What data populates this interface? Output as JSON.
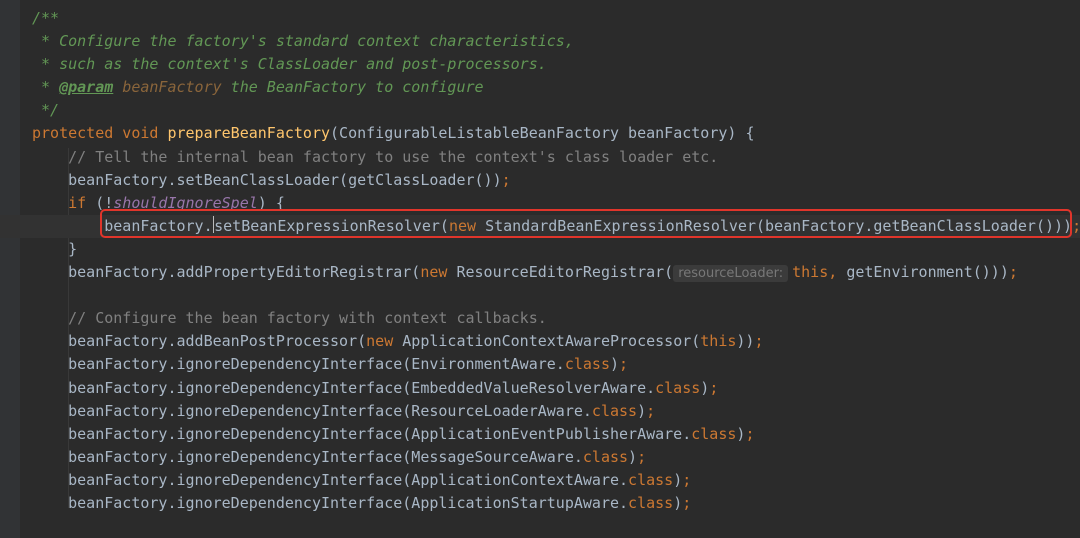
{
  "editor": {
    "lines": [
      {
        "indent": 0,
        "tokens": [
          [
            "cm",
            "/**"
          ]
        ]
      },
      {
        "indent": 0,
        "tokens": [
          [
            "cm",
            " * Configure the factory's standard context characteristics,"
          ]
        ]
      },
      {
        "indent": 0,
        "tokens": [
          [
            "cm",
            " * such as the context's ClassLoader and post-processors."
          ]
        ]
      },
      {
        "indent": 0,
        "tokens": [
          [
            "cm",
            " * "
          ],
          [
            "cm-tag",
            "@param"
          ],
          [
            "cm",
            " "
          ],
          [
            "cm-param",
            "beanFactory"
          ],
          [
            "cm",
            " the BeanFactory to configure"
          ]
        ]
      },
      {
        "indent": 0,
        "tokens": [
          [
            "cm",
            " */"
          ]
        ]
      },
      {
        "indent": 0,
        "tokens": [
          [
            "kw",
            "protected void "
          ],
          [
            "fn",
            "prepareBeanFactory"
          ],
          [
            "",
            "(ConfigurableListableBeanFactory beanFactory) {"
          ]
        ]
      },
      {
        "indent": 1,
        "tokens": [
          [
            "lc",
            "// Tell the internal bean factory to use the context's class loader etc."
          ]
        ]
      },
      {
        "indent": 1,
        "tokens": [
          [
            "",
            "beanFactory.setBeanClassLoader(getClassLoader())"
          ],
          [
            "kw",
            ";"
          ]
        ]
      },
      {
        "indent": 1,
        "tokens": [
          [
            "kw",
            "if "
          ],
          [
            "",
            "(!"
          ],
          [
            "fld",
            "shouldIgnoreSpel"
          ],
          [
            "",
            ") {"
          ]
        ]
      },
      {
        "indent": 2,
        "current": true,
        "tokens": [
          [
            "",
            "beanFactory."
          ],
          [
            "caret",
            ""
          ],
          [
            "",
            "setBeanExpressionResolver("
          ],
          [
            "kw",
            "new "
          ],
          [
            "",
            "StandardBeanExpressionResolver(beanFactory.getBeanClassLoader()))"
          ],
          [
            "kw",
            ";"
          ]
        ]
      },
      {
        "indent": 1,
        "tokens": [
          [
            "",
            "}"
          ]
        ]
      },
      {
        "indent": 1,
        "tokens": [
          [
            "",
            "beanFactory.addPropertyEditorRegistrar("
          ],
          [
            "kw",
            "new "
          ],
          [
            "",
            "ResourceEditorRegistrar("
          ],
          [
            "hint",
            "resourceLoader:"
          ],
          [
            "kw",
            "this, "
          ],
          [
            "",
            "getEnvironment()))"
          ],
          [
            "kw",
            ";"
          ]
        ]
      },
      {
        "indent": 0,
        "tokens": []
      },
      {
        "indent": 1,
        "tokens": [
          [
            "lc",
            "// Configure the bean factory with context callbacks."
          ]
        ]
      },
      {
        "indent": 1,
        "tokens": [
          [
            "",
            "beanFactory.addBeanPostProcessor("
          ],
          [
            "kw",
            "new "
          ],
          [
            "",
            "ApplicationContextAwareProcessor("
          ],
          [
            "kw",
            "this"
          ],
          [
            "",
            "))"
          ],
          [
            "kw",
            ";"
          ]
        ]
      },
      {
        "indent": 1,
        "tokens": [
          [
            "",
            "beanFactory.ignoreDependencyInterface(EnvironmentAware."
          ],
          [
            "kw",
            "class"
          ],
          [
            "",
            ")"
          ],
          [
            "kw",
            ";"
          ]
        ]
      },
      {
        "indent": 1,
        "tokens": [
          [
            "",
            "beanFactory.ignoreDependencyInterface(EmbeddedValueResolverAware."
          ],
          [
            "kw",
            "class"
          ],
          [
            "",
            ")"
          ],
          [
            "kw",
            ";"
          ]
        ]
      },
      {
        "indent": 1,
        "tokens": [
          [
            "",
            "beanFactory.ignoreDependencyInterface(ResourceLoaderAware."
          ],
          [
            "kw",
            "class"
          ],
          [
            "",
            ")"
          ],
          [
            "kw",
            ";"
          ]
        ]
      },
      {
        "indent": 1,
        "tokens": [
          [
            "",
            "beanFactory.ignoreDependencyInterface(ApplicationEventPublisherAware."
          ],
          [
            "kw",
            "class"
          ],
          [
            "",
            ")"
          ],
          [
            "kw",
            ";"
          ]
        ]
      },
      {
        "indent": 1,
        "tokens": [
          [
            "",
            "beanFactory.ignoreDependencyInterface(MessageSourceAware."
          ],
          [
            "kw",
            "class"
          ],
          [
            "",
            ")"
          ],
          [
            "kw",
            ";"
          ]
        ]
      },
      {
        "indent": 1,
        "tokens": [
          [
            "",
            "beanFactory.ignoreDependencyInterface(ApplicationContextAware."
          ],
          [
            "kw",
            "class"
          ],
          [
            "",
            ")"
          ],
          [
            "kw",
            ";"
          ]
        ]
      },
      {
        "indent": 1,
        "tokens": [
          [
            "",
            "beanFactory.ignoreDependencyInterface(ApplicationStartupAware."
          ],
          [
            "kw",
            "class"
          ],
          [
            "",
            ")"
          ],
          [
            "kw",
            ";"
          ]
        ]
      }
    ]
  },
  "colors": {
    "background": "#2b2b2b",
    "default_text": "#a9b7c6",
    "keyword": "#cc7832",
    "method_declaration": "#ffc66d",
    "doc_comment": "#629755",
    "line_comment": "#808080",
    "field": "#9876aa",
    "highlight_box": "#e0352b"
  }
}
